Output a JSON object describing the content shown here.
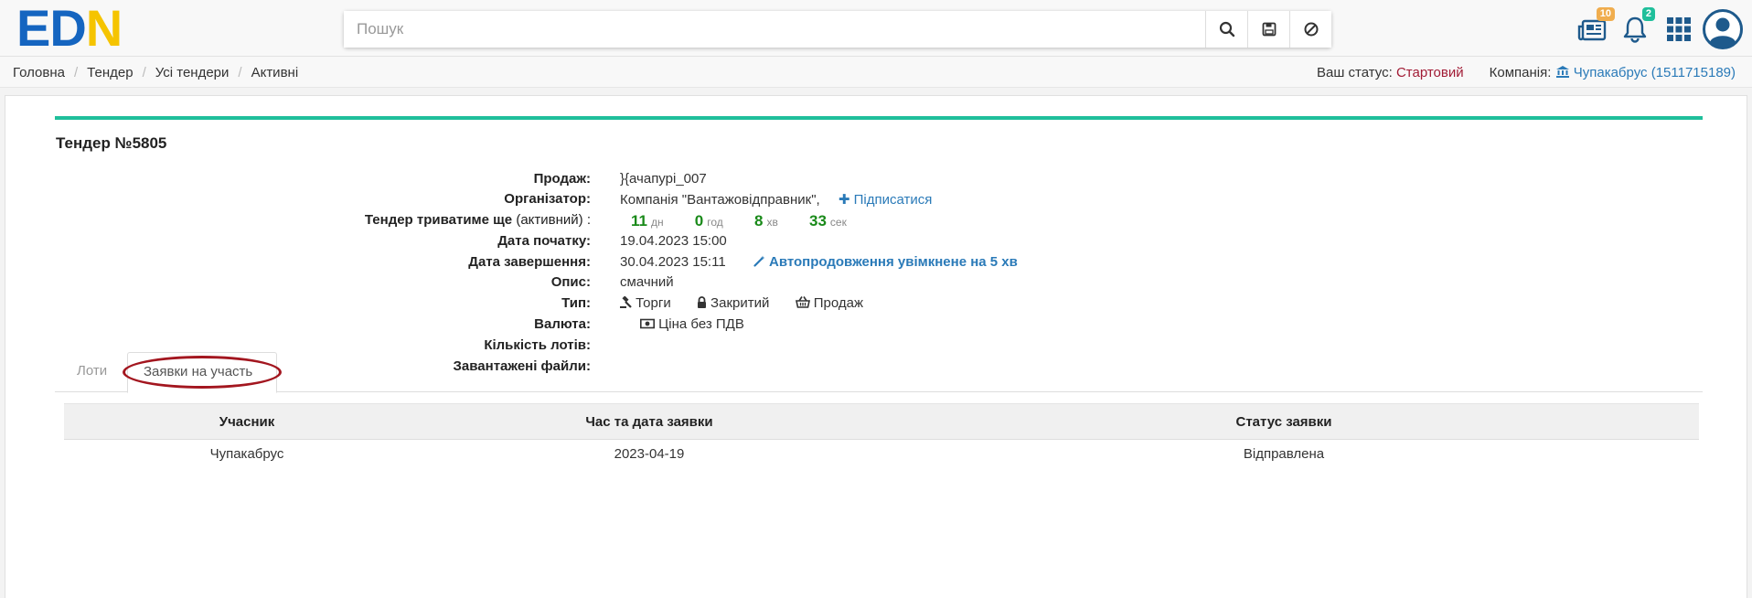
{
  "header": {
    "logo_left": "ED",
    "logo_right": "N",
    "search_placeholder": "Пошук",
    "news_badge": "10",
    "notif_badge": "2",
    "colors": {
      "brand_blue": "#1565c0",
      "brand_yellow": "#f5c400",
      "news_badge": "#f0ad4e",
      "notif_badge": "#1fbf9b"
    }
  },
  "breadcrumb": [
    "Головна",
    "Тендер",
    "Усі тендери",
    "Активні"
  ],
  "status": {
    "label": "Ваш статус:",
    "value": "Стартовий",
    "company_label": "Компанія:",
    "company_value": "Чупакабрус (1511715189)"
  },
  "tender": {
    "title": "Тендер №5805",
    "fields": {
      "sale_label": "Продаж:",
      "sale_value": "}{ачапурі_007",
      "org_label": "Організатор:",
      "org_value": "Компанія \"Вантажовідправник\",",
      "subscribe": "Підписатися",
      "duration_label": "Тендер триватиме ще",
      "duration_state": "(активний) :",
      "start_label": "Дата початку:",
      "start_value": "19.04.2023 15:00",
      "end_label": "Дата завершення:",
      "end_value": "30.04.2023 15:11",
      "autoextend": "Автопродовження увімкнене на 5 хв",
      "desc_label": "Опис:",
      "desc_value": "смачний",
      "type_label": "Тип:",
      "type_values": [
        "Торги",
        "Закритий",
        "Продаж"
      ],
      "currency_label": "Валюта:",
      "currency_value": "Ціна без ПДВ",
      "lots_label": "Кількість лотів:",
      "files_label": "Завантажені файли:"
    },
    "countdown": [
      {
        "num": "11",
        "unit": "дн"
      },
      {
        "num": "0",
        "unit": "год"
      },
      {
        "num": "8",
        "unit": "хв"
      },
      {
        "num": "33",
        "unit": "сек"
      }
    ]
  },
  "tabs": {
    "lots": "Лоти",
    "applications": "Заявки на участь",
    "active": "applications"
  },
  "table": {
    "headers": [
      "Учасник",
      "Час та дата заявки",
      "Статус заявки"
    ],
    "rows": [
      [
        "Чупакабрус",
        "2023-04-19",
        "Відправлена"
      ]
    ]
  }
}
